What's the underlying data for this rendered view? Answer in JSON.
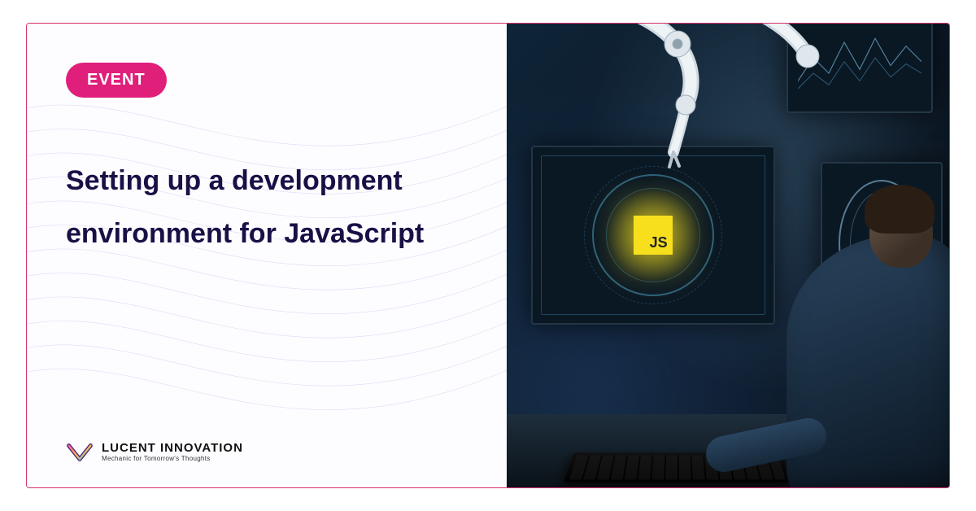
{
  "badge": {
    "label": "EVENT"
  },
  "title": "Setting up a development environment for JavaScript",
  "brand": {
    "name": "LUCENT INNOVATION",
    "tagline": "Mechanic for Tomorrow's Thoughts"
  },
  "hero": {
    "js_label": "JS"
  },
  "colors": {
    "accent": "#e01f7a",
    "border": "#d6336c",
    "heading": "#1a1046",
    "js_yellow": "#f7df1e"
  }
}
